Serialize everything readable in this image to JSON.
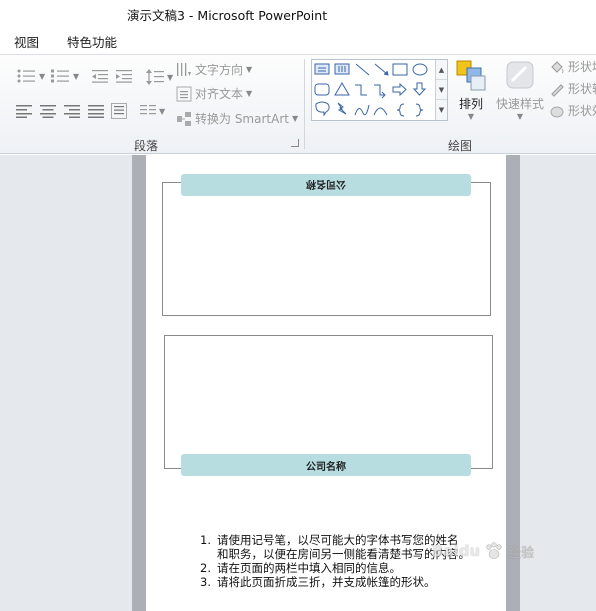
{
  "window": {
    "title": "演示文稿3  -  Microsoft PowerPoint"
  },
  "menu": {
    "items": [
      "视图",
      "特色功能"
    ]
  },
  "ribbon": {
    "paragraph_group_label": "段落",
    "text_direction_label": "文字方向",
    "align_text_label": "对齐文本",
    "convert_smartart_label": "转换为 SmartArt",
    "drawing_group_label": "绘图",
    "arrange_label": "排列",
    "quick_styles_label": "快速样式",
    "shape_fill_label": "形状填",
    "shape_outline_label": "形状轮",
    "shape_effects_label": "形状效"
  },
  "slide": {
    "top_label": "公司名称",
    "bottom_label": "公司名称",
    "instructions": [
      {
        "num": "1.",
        "text": "请使用记号笔，以尽可能大的字体书写您的姓名"
      },
      {
        "num": "",
        "text": "和职务，以便在房间另一侧能看清楚书写的内容。"
      },
      {
        "num": "2.",
        "text": "请在页面的两栏中填入相同的信息。"
      },
      {
        "num": "3.",
        "text": "请将此页面折成三折，并支成帐篷的形状。"
      }
    ]
  },
  "watermark": {
    "brand": "Baidu",
    "cn": "经验"
  },
  "colors": {
    "label_bar": "#b7dde1",
    "workspace": "#acb0b6"
  }
}
